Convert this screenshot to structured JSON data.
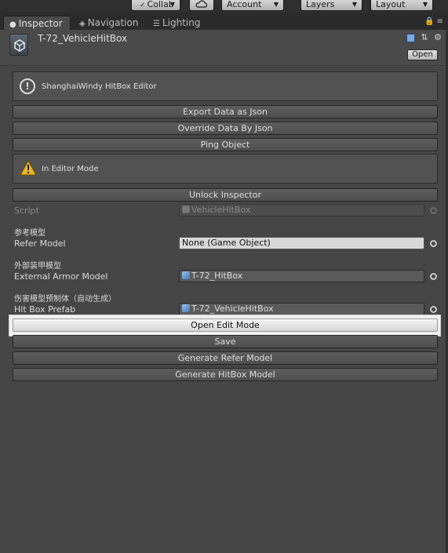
{
  "toolbar": {
    "collab_label": "Collab",
    "account_label": "Account",
    "layers_label": "Layers",
    "layout_label": "Layout"
  },
  "tabs": [
    {
      "label": "Inspector",
      "icon": "info-icon"
    },
    {
      "label": "Navigation",
      "icon": "compass-icon"
    },
    {
      "label": "Lighting",
      "icon": "sliders-icon"
    }
  ],
  "header": {
    "object_name": "T-72_VehicleHitBox",
    "open_label": "Open"
  },
  "help": {
    "info_text": "ShanghaiWindy HitBox Editor",
    "warn_text": "In Editor Mode"
  },
  "buttons": {
    "export_json": "Export Data as Json",
    "override_json": "Override Data By Json",
    "ping_object": "Ping Object",
    "unlock_inspector": "Unlock Inspector",
    "open_edit_mode": "Open Edit Mode",
    "save": "Save",
    "generate_refer": "Generate Refer Model",
    "generate_hitbox": "Generate HitBox Model"
  },
  "properties": {
    "script_label": "Script",
    "script_value": "VehicleHitBox",
    "refer_section": "参考模型",
    "refer_label": "Refer Model",
    "refer_value": "None (Game Object)",
    "armor_section": "外部装甲模型",
    "armor_label": "External Armor Model",
    "armor_value": "T-72_HitBox",
    "prefab_section": "伤害模型预制体（自动生成）",
    "prefab_label": "Hit Box Prefab",
    "prefab_value": "T-72_VehicleHitBox"
  }
}
